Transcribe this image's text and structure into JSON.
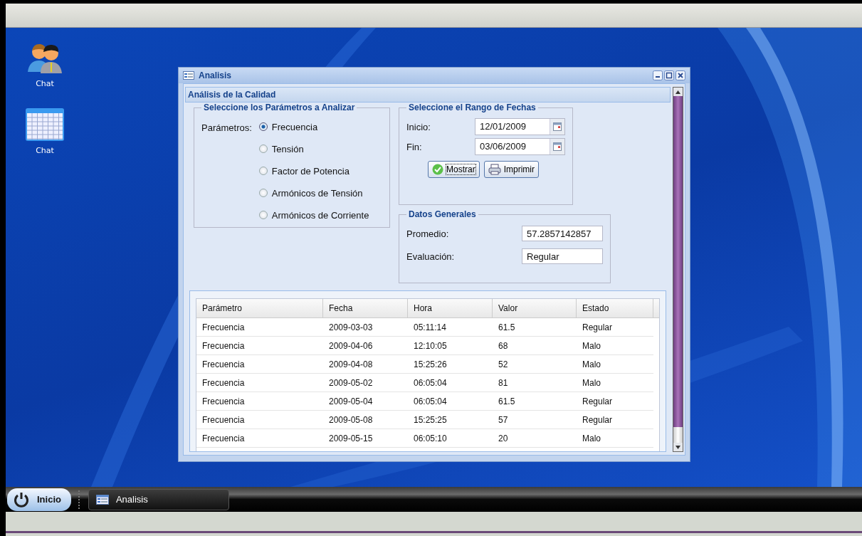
{
  "desktop": {
    "icons": [
      {
        "label": "Chat",
        "kind": "people"
      },
      {
        "label": "Chat",
        "kind": "calendar"
      }
    ]
  },
  "window": {
    "title": "Analisis",
    "section_title": "Análisis de la Calidad",
    "parameters": {
      "legend": "Seleccione los Parámetros a Analizar",
      "label": "Parámetros:",
      "options": [
        {
          "label": "Frecuencia",
          "selected": true
        },
        {
          "label": "Tensión",
          "selected": false
        },
        {
          "label": "Factor de Potencia",
          "selected": false
        },
        {
          "label": "Armónicos de Tensión",
          "selected": false
        },
        {
          "label": "Armónicos de Corriente",
          "selected": false
        }
      ]
    },
    "date_range": {
      "legend": "Seleccione el Rango de Fechas",
      "fields": [
        {
          "label": "Inicio:",
          "value": "12/01/2009"
        },
        {
          "label": "Fin:",
          "value": "03/06/2009"
        }
      ],
      "buttons": [
        {
          "label": "Mostrar",
          "kind": "ok",
          "focused": true
        },
        {
          "label": "Imprimir",
          "kind": "print",
          "focused": false
        }
      ]
    },
    "general": {
      "legend": "Datos Generales",
      "fields": [
        {
          "label": "Promedio:",
          "value": "57.2857142857"
        },
        {
          "label": "Evaluación:",
          "value": "Regular"
        }
      ]
    },
    "table": {
      "columns": [
        "Parámetro",
        "Fecha",
        "Hora",
        "Valor",
        "Estado"
      ],
      "rows": [
        [
          "Frecuencia",
          "2009-03-03",
          "05:11:14",
          "61.5",
          "Regular"
        ],
        [
          "Frecuencia",
          "2009-04-06",
          "12:10:05",
          "68",
          "Malo"
        ],
        [
          "Frecuencia",
          "2009-04-08",
          "15:25:26",
          "52",
          "Malo"
        ],
        [
          "Frecuencia",
          "2009-05-02",
          "06:05:04",
          "81",
          "Malo"
        ],
        [
          "Frecuencia",
          "2009-05-04",
          "06:05:04",
          "61.5",
          "Regular"
        ],
        [
          "Frecuencia",
          "2009-05-08",
          "15:25:25",
          "57",
          "Regular"
        ],
        [
          "Frecuencia",
          "2009-05-15",
          "06:05:10",
          "20",
          "Malo"
        ]
      ]
    }
  },
  "taskbar": {
    "start": "Inicio",
    "tasks": [
      {
        "label": "Analisis"
      }
    ]
  }
}
